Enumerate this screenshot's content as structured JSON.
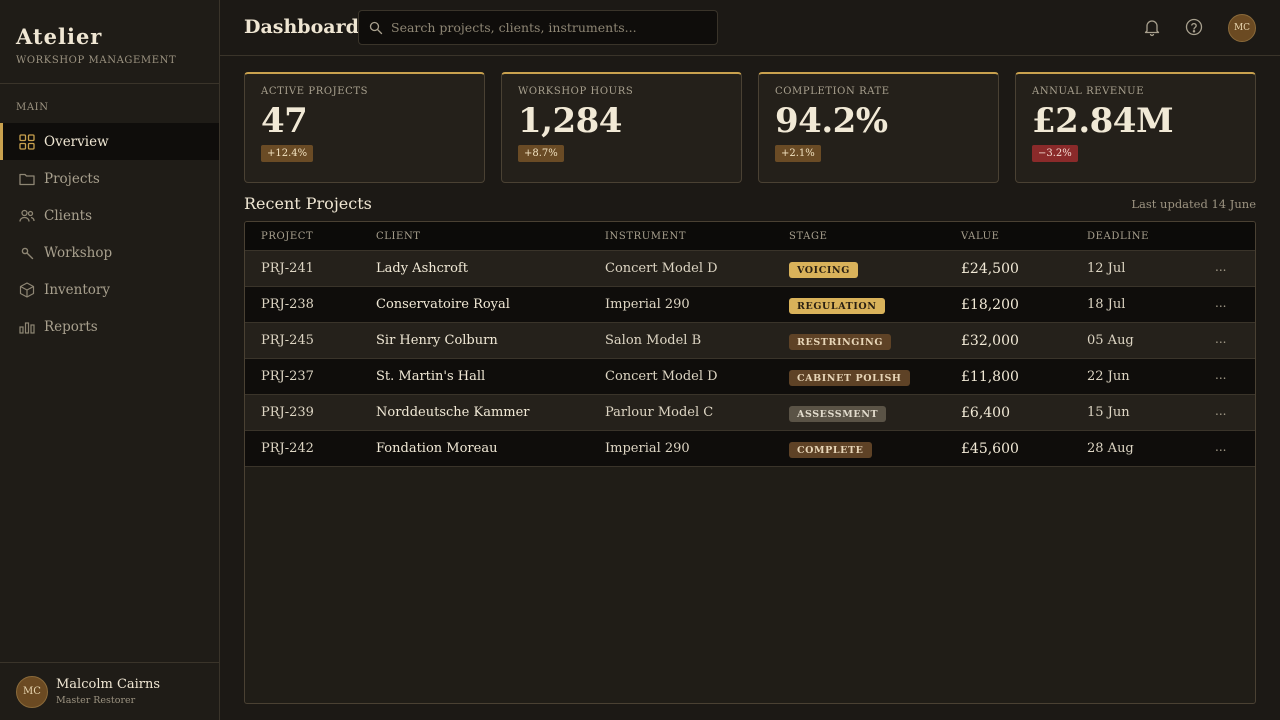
{
  "brand": {
    "title": "Atelier",
    "subtitle": "Workshop Management"
  },
  "sidebar": {
    "section": "Main",
    "items": [
      {
        "label": "Overview",
        "icon": "grid-icon"
      },
      {
        "label": "Projects",
        "icon": "folder-icon"
      },
      {
        "label": "Clients",
        "icon": "users-icon"
      },
      {
        "label": "Workshop",
        "icon": "wrench-icon"
      },
      {
        "label": "Inventory",
        "icon": "box-icon"
      },
      {
        "label": "Reports",
        "icon": "bar-chart-icon"
      }
    ],
    "active": "Overview"
  },
  "user": {
    "initials": "MC",
    "name": "Malcolm Cairns",
    "role": "Master Restorer"
  },
  "header": {
    "title": "Dashboard",
    "search_placeholder": "Search projects, clients, instruments...",
    "avatar_initials": "MC"
  },
  "stats": [
    {
      "label": "Active Projects",
      "value": "47",
      "delta": "+12.4%",
      "trend": "up"
    },
    {
      "label": "Workshop Hours",
      "value": "1,284",
      "delta": "+8.7%",
      "trend": "up"
    },
    {
      "label": "Completion Rate",
      "value": "94.2%",
      "delta": "+2.1%",
      "trend": "up"
    },
    {
      "label": "Annual Revenue",
      "value": "£2.84M",
      "delta": "−3.2%",
      "trend": "down"
    }
  ],
  "recent": {
    "title": "Recent Projects",
    "updated": "Last updated 14 June",
    "columns": [
      "Project",
      "Client",
      "Instrument",
      "Stage",
      "Value",
      "Deadline"
    ],
    "rows": [
      {
        "project": "PRJ-241",
        "client": "Lady Ashcroft",
        "instrument": "Concert Model D",
        "stage": "Voicing",
        "stage_bg": "#d9b25a",
        "stage_fg": "#2a2012",
        "value": "£24,500",
        "deadline": "12 Jul",
        "more": "..."
      },
      {
        "project": "PRJ-238",
        "client": "Conservatoire Royal",
        "instrument": "Imperial 290",
        "stage": "Regulation",
        "stage_bg": "#d9b25a",
        "stage_fg": "#2a2012",
        "value": "£18,200",
        "deadline": "18 Jul",
        "more": "..."
      },
      {
        "project": "PRJ-245",
        "client": "Sir Henry Colburn",
        "instrument": "Salon Model B",
        "stage": "Restringing",
        "stage_bg": "#5e4226",
        "stage_fg": "#e8d6b8",
        "value": "£32,000",
        "deadline": "05 Aug",
        "more": "..."
      },
      {
        "project": "PRJ-237",
        "client": "St. Martin's Hall",
        "instrument": "Concert Model D",
        "stage": "Cabinet Polish",
        "stage_bg": "#5e4226",
        "stage_fg": "#e8d6b8",
        "value": "£11,800",
        "deadline": "22 Jun",
        "more": "..."
      },
      {
        "project": "PRJ-239",
        "client": "Norddeutsche Kammer",
        "instrument": "Parlour Model C",
        "stage": "Assessment",
        "stage_bg": "#5a5346",
        "stage_fg": "#e2dccd",
        "value": "£6,400",
        "deadline": "15 Jun",
        "more": "..."
      },
      {
        "project": "PRJ-242",
        "client": "Fondation Moreau",
        "instrument": "Imperial 290",
        "stage": "Complete",
        "stage_bg": "#5e4226",
        "stage_fg": "#e8d6b8",
        "value": "£45,600",
        "deadline": "28 Aug",
        "more": "..."
      }
    ]
  },
  "colors": {
    "accent": "#c9a14e",
    "negative": "#8a2a2a",
    "background": "#1c1915"
  }
}
